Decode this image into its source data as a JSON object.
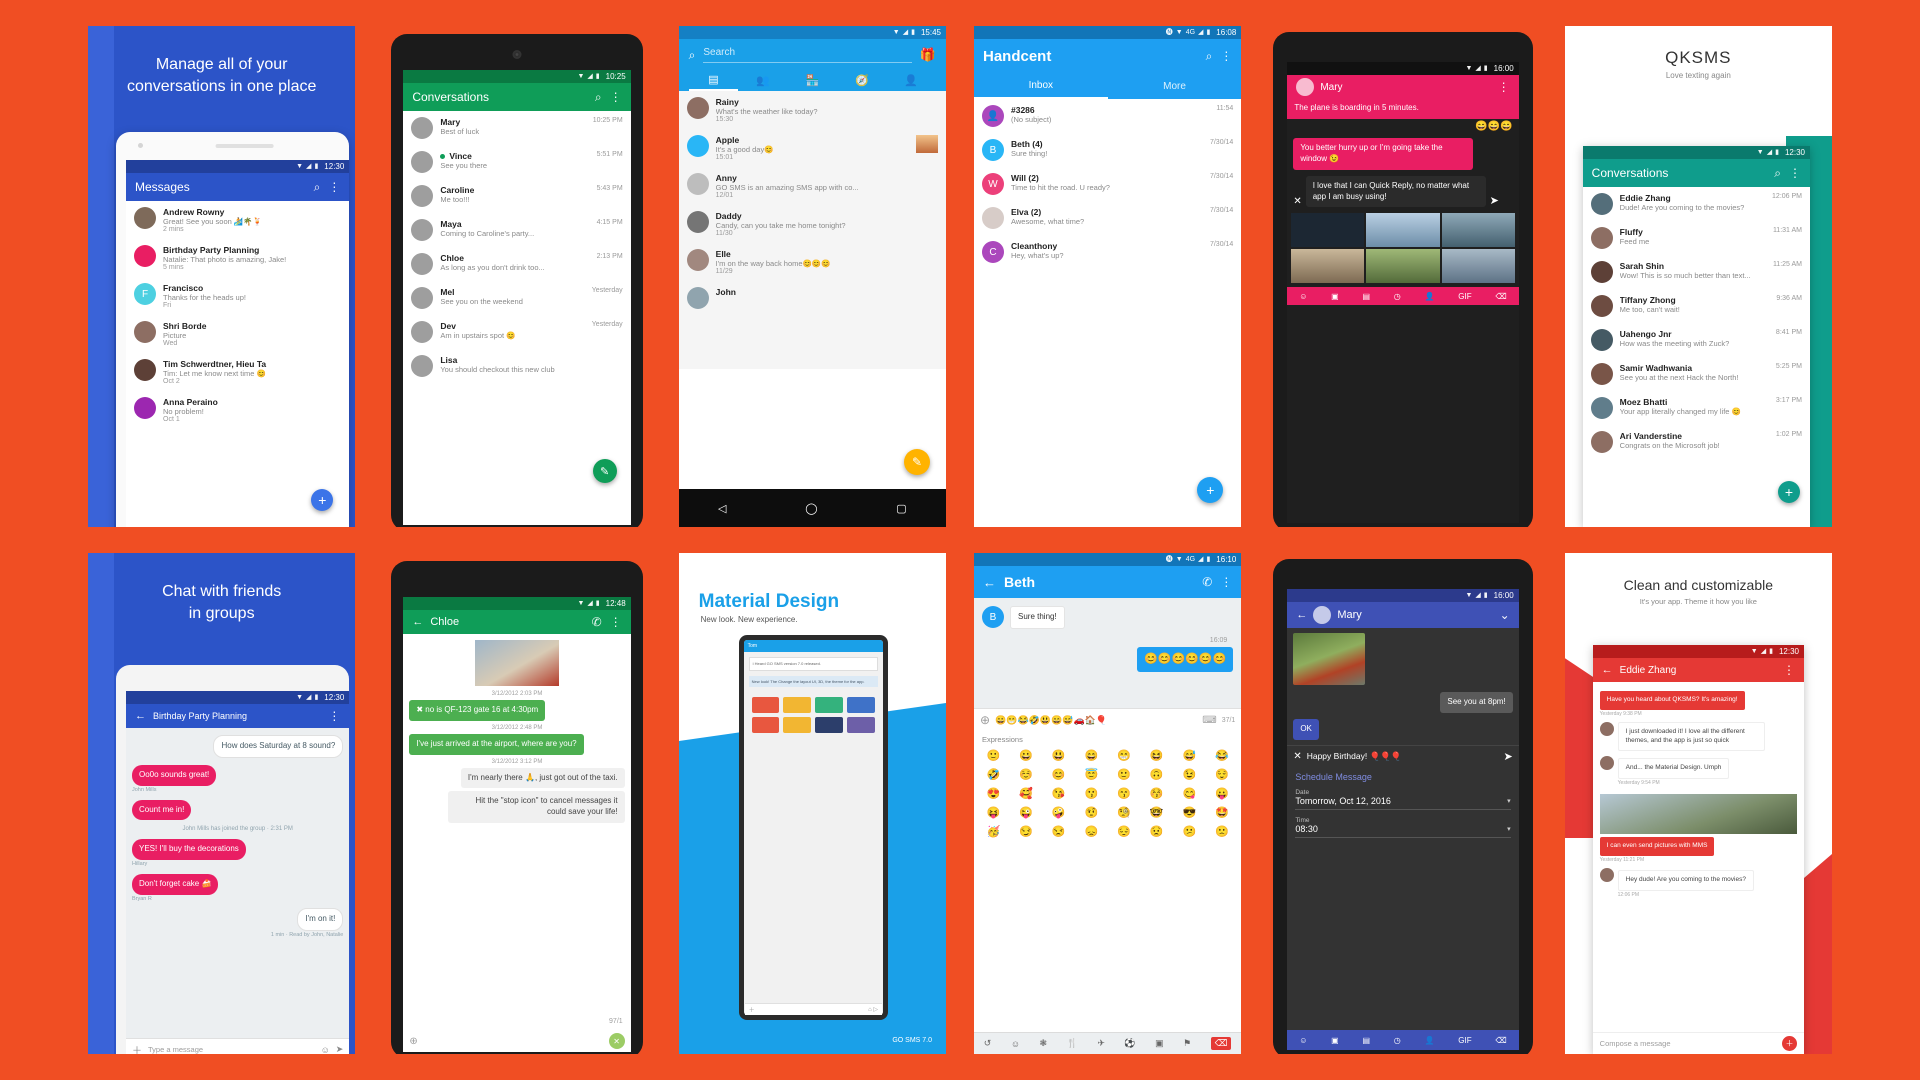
{
  "background_color": "#f04e23",
  "panels": [
    {
      "id": "messages-promo",
      "headline": "Manage all of your\nconversations in one place",
      "accent": "#2c54c8",
      "statusbar": {
        "time": "12:30"
      },
      "appbar": {
        "title": "Messages",
        "icons": [
          "search-icon",
          "overflow-icon"
        ]
      },
      "rows": [
        {
          "name": "Andrew Rowny",
          "msg": "Great! See you soon 🏄🌴🍹",
          "time": "2 mins",
          "color": "#7e6a5a",
          "initial": ""
        },
        {
          "name": "Birthday Party Planning",
          "msg": "Natalie: That photo is amazing, Jake!",
          "time": "5 mins",
          "color": "#e91e63",
          "initial": ""
        },
        {
          "name": "Francisco",
          "msg": "Thanks for the heads up!",
          "time": "Fri",
          "color": "#4dd0e1",
          "initial": "F"
        },
        {
          "name": "Shri Borde",
          "msg": "Picture",
          "time": "Wed",
          "color": "#8d6e63",
          "initial": ""
        },
        {
          "name": "Tim Schwerdtner, Hieu Ta",
          "msg": "Tim: Let me know next time 😊",
          "time": "Oct 2",
          "color": "#5d4037",
          "initial": ""
        },
        {
          "name": "Anna Peraino",
          "msg": "No problem!",
          "time": "Oct 1",
          "color": "#9c27b0",
          "initial": ""
        }
      ],
      "fab": "+"
    },
    {
      "id": "conversations-green",
      "accent": "#0f9d58",
      "statusbar": {
        "time": "10:25"
      },
      "appbar": {
        "title": "Conversations",
        "icons": [
          "search-icon",
          "overflow-icon"
        ]
      },
      "rows": [
        {
          "name": "Mary",
          "msg": "Best of luck",
          "time": "10:25 PM",
          "online": false
        },
        {
          "name": "Vince",
          "msg": "See you there",
          "time": "5:51 PM",
          "online": true
        },
        {
          "name": "Caroline",
          "msg": "Me too!!!",
          "time": "5:43 PM",
          "online": false
        },
        {
          "name": "Maya",
          "msg": "Coming to Caroline's party...",
          "time": "4:15 PM",
          "online": false
        },
        {
          "name": "Chloe",
          "msg": "As long as you don't drink too...",
          "time": "2:13 PM",
          "online": false
        },
        {
          "name": "Mel",
          "msg": "See you on the weekend",
          "time": "Yesterday",
          "online": false
        },
        {
          "name": "Dev",
          "msg": "Am in upstairs spot 😊",
          "time": "Yesterday",
          "online": false
        },
        {
          "name": "Lisa",
          "msg": "You should checkout this new club",
          "time": "",
          "online": false
        }
      ],
      "fab": "✎"
    },
    {
      "id": "go-sms",
      "accent": "#1aa0e8",
      "statusbar": {
        "time": "15:45"
      },
      "search": {
        "placeholder": "Search",
        "icon": "search-icon",
        "gift_icon": "gift-icon"
      },
      "tabs": [
        "messages-tab-icon",
        "contacts-tab-icon",
        "store-tab-icon",
        "discover-tab-icon",
        "profile-tab-icon"
      ],
      "rows": [
        {
          "name": "Rainy",
          "msg": "What's the weather like today?",
          "time": "15:30",
          "color": "#8d6e63"
        },
        {
          "name": "Apple",
          "msg": "It's a good day😊",
          "time": "15:01",
          "color": "#29b6f6",
          "thumb": true
        },
        {
          "name": "Anny",
          "msg": "GO SMS is an amazing SMS app with co...",
          "time": "12/01",
          "color": "#bdbdbd"
        },
        {
          "name": "Daddy",
          "msg": "Candy, can you take me home tonight?",
          "time": "11/30",
          "color": "#757575"
        },
        {
          "name": "Elle",
          "msg": "I'm on the way back home😊😊😊",
          "time": "11/29",
          "color": "#a1887f"
        },
        {
          "name": "John",
          "msg": "",
          "time": "",
          "color": "#90a4ae"
        }
      ],
      "fab": "✎",
      "navbar": [
        "back-nav-icon",
        "home-nav-icon",
        "recents-nav-icon"
      ]
    },
    {
      "id": "handcent",
      "accent": "#1e9ff2",
      "statusbar": {
        "time": "16:08",
        "icons": [
          "nfc-icon",
          "wifi-icon",
          "4g-icon",
          "signal-icon",
          "battery-icon"
        ]
      },
      "appbar": {
        "title": "Handcent",
        "icons": [
          "search-icon",
          "overflow-icon"
        ]
      },
      "tabs": [
        {
          "label": "Inbox",
          "active": true
        },
        {
          "label": "More",
          "active": false
        }
      ],
      "rows": [
        {
          "name": "#3286",
          "msg": "(No subject)",
          "time": "11:54",
          "color": "#ab47bc",
          "initial": "👤"
        },
        {
          "name": "Beth (4)",
          "msg": "Sure thing!",
          "time": "7/30/14",
          "color": "#29b6f6",
          "initial": "B"
        },
        {
          "name": "Will (2)",
          "msg": "Time to hit the road. U ready?",
          "time": "7/30/14",
          "color": "#ec407a",
          "initial": "W"
        },
        {
          "name": "Elva (2)",
          "msg": "Awesome, what time?",
          "time": "7/30/14",
          "color": "#d7ccc8",
          "initial": ""
        },
        {
          "name": "Cleanthony",
          "msg": "Hey, what's up?",
          "time": "7/30/14",
          "color": "#ab47bc",
          "initial": "C"
        }
      ],
      "fab": "+"
    },
    {
      "id": "mary-quick-reply",
      "accent": "#e91e63",
      "statusbar": {
        "time": "16:00"
      },
      "appbar": {
        "title": "Mary",
        "icons": [
          "overflow-icon"
        ]
      },
      "messages": [
        {
          "text": "The plane is boarding in 5 minutes.",
          "side": "in"
        },
        {
          "text": "You better hurry up or I'm going take the window 😉",
          "side": "in"
        },
        {
          "text": "I love that I can Quick Reply, no matter what app I am busy using!",
          "side": "out"
        }
      ],
      "reactions": [
        "😄",
        "😄",
        "😄"
      ],
      "toolbar_icons": [
        "emoji-icon",
        "camera-icon",
        "gallery-icon",
        "history-icon",
        "contact-icon",
        "gif-icon",
        "delete-icon"
      ],
      "close_icon": "close-icon",
      "send_icon": "send-icon"
    },
    {
      "id": "qksms",
      "brand": "QKSMS",
      "tagline": "Love texting again",
      "accent": "#0f9d8c",
      "statusbar": {
        "time": "12:30"
      },
      "appbar": {
        "title": "Conversations",
        "icons": [
          "search-icon",
          "overflow-icon"
        ]
      },
      "rows": [
        {
          "name": "Eddie Zhang",
          "msg": "Dude! Are you coming to the movies?",
          "time": "12:06 PM",
          "color": "#546e7a"
        },
        {
          "name": "Fluffy",
          "msg": "Feed me",
          "time": "11:31 AM",
          "color": "#8d6e63"
        },
        {
          "name": "Sarah Shin",
          "msg": "Wow! This is so much better than text...",
          "time": "11:25 AM",
          "color": "#5d4037"
        },
        {
          "name": "Tiffany Zhong",
          "msg": "Me too, can't wait!",
          "time": "9:36 AM",
          "color": "#6d4c41"
        },
        {
          "name": "Uahengo Jnr",
          "msg": "How was the meeting with Zuck?",
          "time": "8:41 PM",
          "color": "#455a64"
        },
        {
          "name": "Samir Wadhwania",
          "msg": "See you at the next Hack the North!",
          "time": "5:25 PM",
          "color": "#795548"
        },
        {
          "name": "Moez Bhatti",
          "msg": "Your app literally changed my life 😊",
          "time": "3:17 PM",
          "color": "#607d8b"
        },
        {
          "name": "Ari Vanderstine",
          "msg": "Congrats on the Microsoft job!",
          "time": "1:02 PM",
          "color": "#8d6e63"
        }
      ],
      "fab": "+"
    },
    {
      "id": "groups-promo",
      "headline": "Chat with friends\nin groups",
      "accent": "#2c54c8",
      "statusbar": {
        "time": "12:30"
      },
      "appbar": {
        "title": "Birthday Party Planning",
        "icons": [
          "back-icon",
          "overflow-icon"
        ]
      },
      "messages": [
        {
          "text": "How does Saturday at 8 sound?",
          "side": "in",
          "author": "",
          "color": "#ffffff"
        },
        {
          "text": "Oo0o sounds great!",
          "side": "out",
          "author": "John Mills",
          "color": "#e91e63"
        },
        {
          "text": "Count me in!",
          "side": "out",
          "author": "",
          "color": "#e91e63"
        },
        {
          "text": "John Mills has joined the group · 2:31 PM",
          "side": "system",
          "author": "",
          "color": ""
        },
        {
          "text": "YES! I'll buy the decorations",
          "side": "out",
          "author": "Hillary",
          "color": "#e91e63"
        },
        {
          "text": "Don't forget cake 🍰",
          "side": "out",
          "author": "Bryan R",
          "color": "#e91e63"
        },
        {
          "text": "I'm on it!",
          "side": "in",
          "author": "1 min · Read by John, Natalie",
          "color": "#ffffff"
        }
      ],
      "composer": {
        "placeholder": "Type a message",
        "icons": [
          "add-icon",
          "emoji-icon",
          "send-icon"
        ]
      }
    },
    {
      "id": "chloe-chat",
      "accent": "#0f9d58",
      "statusbar": {
        "time": "12:48"
      },
      "appbar": {
        "title": "Chloe",
        "icons": [
          "back-icon",
          "call-icon",
          "overflow-icon"
        ]
      },
      "messages": [
        {
          "ts": "3/12/2012 2:03 PM",
          "text": "✖ no is QF-123 gate 16 at 4:30pm",
          "side": "out"
        },
        {
          "ts": "3/12/2012 2:48 PM",
          "text": "I've just arrived at the airport, where are you?",
          "side": "out"
        },
        {
          "ts": "3/12/2012 3:12 PM",
          "text": "I'm nearly there 🙏, just got out of the taxi.",
          "side": "in"
        },
        {
          "ts": "",
          "text": "Hit the \"stop icon\" to cancel messages it could save your life!",
          "side": "in"
        }
      ],
      "counter": "97/1",
      "cancel_icon": "cancel-icon"
    },
    {
      "id": "material-design",
      "title": "Material Design",
      "subtitle": "New look. New experience.",
      "footer": "GO SMS 7.0",
      "accent": "#1aa0e8"
    },
    {
      "id": "beth-emoji",
      "accent": "#1e9ff2",
      "statusbar": {
        "time": "16:10",
        "icons": [
          "nfc-icon",
          "wifi-icon",
          "4g-icon",
          "signal-icon",
          "battery-icon"
        ]
      },
      "appbar": {
        "title": "Beth",
        "icons": [
          "back-icon",
          "call-icon",
          "overflow-icon"
        ]
      },
      "messages": [
        {
          "text": "Sure thing!",
          "side": "in",
          "avatar": "B"
        },
        {
          "ts": "16:09",
          "side": "meta",
          "text": "16:09"
        },
        {
          "text": "😊😊😊😊😊😊",
          "side": "out"
        }
      ],
      "composer": {
        "counter": "37/1",
        "icons": [
          "add-icon",
          "keyboard-icon",
          "send-icon"
        ]
      },
      "emoji_section_title": "Expressions",
      "emoji_rows": [
        [
          "🙂",
          "😀",
          "😃",
          "😄",
          "😁",
          "😆",
          "😅",
          "😂"
        ],
        [
          "🤣",
          "☺️",
          "😊",
          "😇",
          "🙂",
          "🙃",
          "😉",
          "😌"
        ],
        [
          "😍",
          "🥰",
          "😘",
          "😗",
          "😙",
          "😚",
          "😋",
          "😛"
        ],
        [
          "😝",
          "😜",
          "🤪",
          "🤨",
          "🧐",
          "🤓",
          "😎",
          "🤩"
        ],
        [
          "🥳",
          "😏",
          "😒",
          "😞",
          "😔",
          "😟",
          "😕",
          "🙁"
        ]
      ],
      "bottom_icons": [
        "undo-icon",
        "smiley-icon",
        "flower-icon",
        "food-icon",
        "travel-icon",
        "activity-icon",
        "object-icon",
        "flag-icon",
        "backspace-icon"
      ]
    },
    {
      "id": "mary-schedule",
      "accent": "#3f51b5",
      "statusbar": {
        "time": "16:00"
      },
      "appbar": {
        "title": "Mary",
        "icons": [
          "back-icon",
          "chevron-down-icon"
        ]
      },
      "messages": [
        {
          "text": "See you at 8pm!",
          "side": "in"
        },
        {
          "text": "OK",
          "side": "out"
        }
      ],
      "composer": {
        "value": "Happy Birthday! 🎈🎈🎈",
        "close_icon": "close-icon",
        "send_icon": "send-icon"
      },
      "schedule": {
        "title": "Schedule Message",
        "date_label": "Date",
        "date_value": "Tomorrow, Oct 12, 2016",
        "time_label": "Time",
        "time_value": "08:30"
      },
      "toolbar_icons": [
        "emoji-icon",
        "camera-icon",
        "gallery-icon",
        "history-icon",
        "contact-icon",
        "gif-icon",
        "delete-icon"
      ]
    },
    {
      "id": "qksms-themes",
      "title": "Clean and customizable",
      "subtitle": "It's your app. Theme it how you like",
      "accent": "#e53935",
      "statusbar": {
        "time": "12:30"
      },
      "appbar": {
        "title": "Eddie Zhang",
        "icons": [
          "back-icon",
          "overflow-icon"
        ]
      },
      "messages": [
        {
          "text": "Have you heard about QKSMS? It's amazing!",
          "side": "out",
          "meta": "Yesterday 9:38 PM"
        },
        {
          "text": "I just downloaded it! I love all the different themes, and the app is just so quick",
          "side": "in",
          "meta": ""
        },
        {
          "text": "And... the Material Design. Umph",
          "side": "in",
          "meta": "Yesterday 9:54 PM"
        },
        {
          "text": "I can even send pictures with MMS",
          "side": "out",
          "meta": "Yesterday 11:21 PM"
        },
        {
          "text": "Hey dude! Are you coming to the movies?",
          "side": "in",
          "meta": "12:06 PM"
        }
      ],
      "composer": {
        "placeholder": "Compose a message",
        "send_icon": "send-icon"
      }
    }
  ]
}
